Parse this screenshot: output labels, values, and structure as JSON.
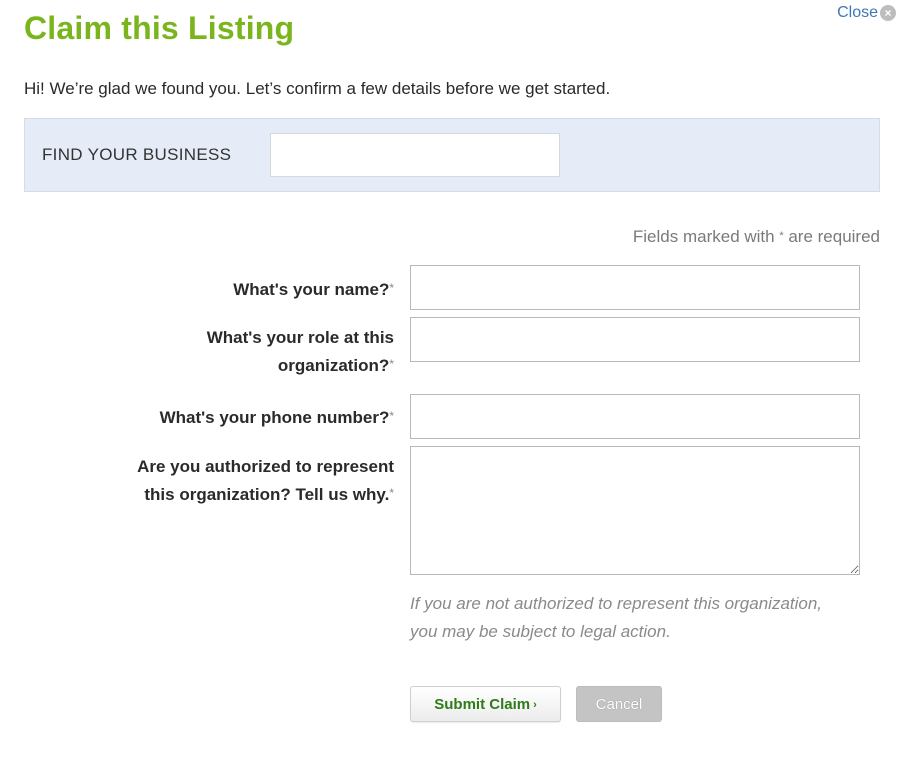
{
  "dialog": {
    "title": "Claim this Listing",
    "close_label": "Close",
    "close_icon": "x-circle-icon",
    "intro": "Hi! We’re glad we found you. Let’s confirm a few details before we get started."
  },
  "find_business": {
    "label": "FIND YOUR BUSINESS",
    "value": "",
    "placeholder": ""
  },
  "required_note": {
    "before": "Fields marked with ",
    "star": "*",
    "after": " are required"
  },
  "fields": [
    {
      "label_line1": "What's your name?",
      "label_line2": "",
      "required_mark": "*",
      "value": ""
    },
    {
      "label_line1": "What's your role at this",
      "label_line2": "organization?",
      "required_mark": "*",
      "value": ""
    },
    {
      "label_line1": "What's your phone number?",
      "label_line2": "",
      "required_mark": "*",
      "value": ""
    },
    {
      "label_line1": "Are you authorized to represent",
      "label_line2": "this organization? Tell us why.",
      "required_mark": "*",
      "value": ""
    }
  ],
  "warning": "If you are not authorized to represent this organization, you may be subject to legal action.",
  "actions": {
    "submit_label": "Submit Claim",
    "submit_chevron": "›",
    "cancel_label": "Cancel"
  },
  "colors": {
    "title_green": "#7ab51d",
    "link_blue": "#3b79b6",
    "find_box_bg": "#e5ecf7",
    "submit_text_green": "#2f7a19",
    "cancel_bg": "#c4c4c4"
  }
}
